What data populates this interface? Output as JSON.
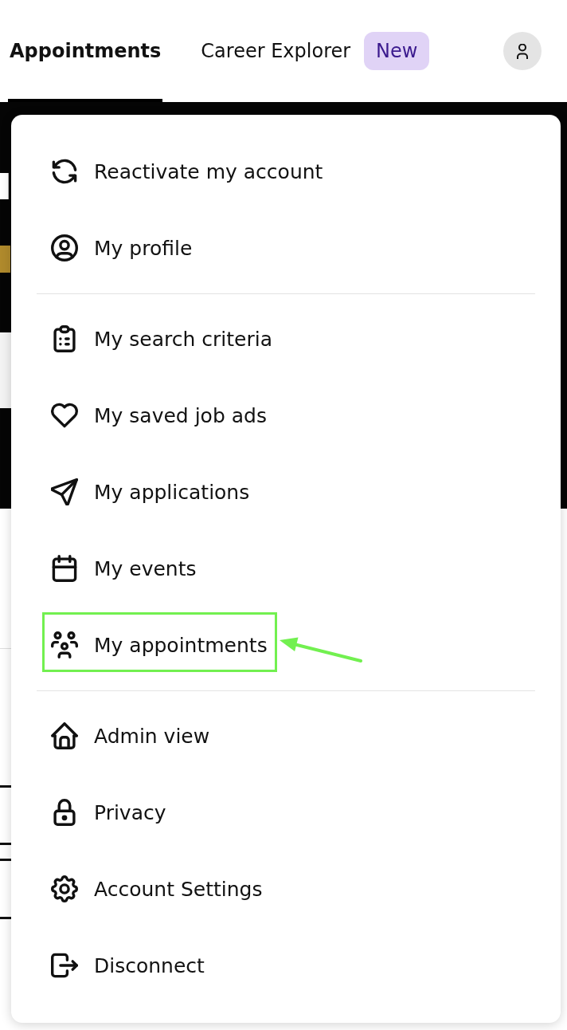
{
  "nav": {
    "tabs": [
      {
        "label": "Appointments",
        "selected": true
      },
      {
        "label": "Career Explorer",
        "selected": false,
        "badge": "New"
      }
    ]
  },
  "menu": {
    "groups": [
      {
        "items": [
          {
            "label": "Reactivate my account",
            "highlighted": false
          },
          {
            "label": "My profile",
            "highlighted": false
          }
        ]
      },
      {
        "items": [
          {
            "label": "My search criteria",
            "highlighted": false
          },
          {
            "label": "My saved job ads",
            "highlighted": false
          },
          {
            "label": "My applications",
            "highlighted": false
          },
          {
            "label": "My events",
            "highlighted": false
          },
          {
            "label": "My appointments",
            "highlighted": true
          }
        ]
      },
      {
        "items": [
          {
            "label": "Admin view",
            "highlighted": false
          },
          {
            "label": "Privacy",
            "highlighted": false
          },
          {
            "label": "Account Settings",
            "highlighted": false
          },
          {
            "label": "Disconnect",
            "highlighted": false
          }
        ]
      }
    ]
  }
}
